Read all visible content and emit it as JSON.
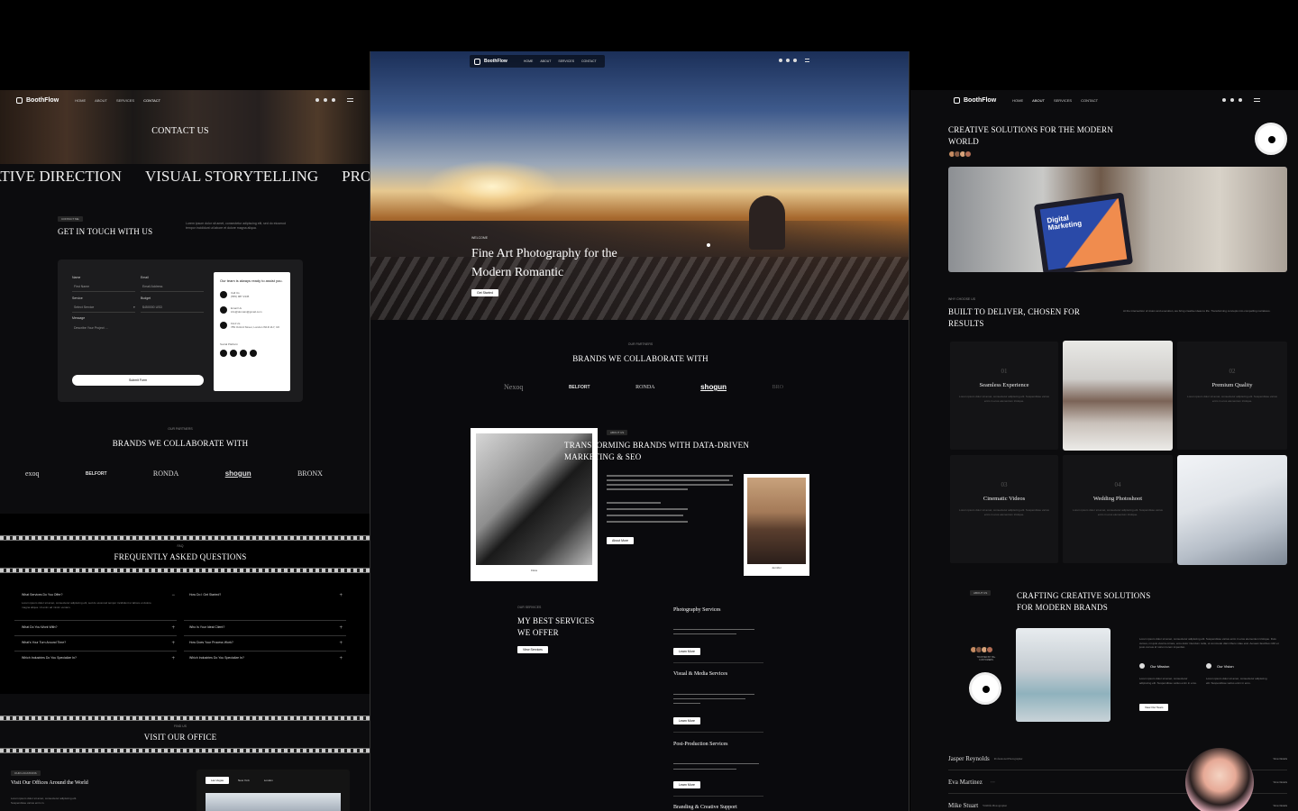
{
  "left": {
    "brand": "BoothFlow",
    "nav": [
      "HOME",
      "ABOUT",
      "SERVICES",
      "CONTACT"
    ],
    "hero_title": "CONTACT US",
    "marquee": [
      "ATIVE DIRECTION",
      "VISUAL STORYTELLING",
      "PROFESSIO"
    ],
    "get_in_touch": {
      "tag": "CONTACT ME",
      "title": "GET IN TOUCH WITH US",
      "desc": "Lorem ipsum dolor sit amet, consectetur adipiscing elit, sed do eiusmod tempor incididunt ut labore et dolore magna aliqua."
    },
    "form": {
      "name_label": "Name",
      "name_placeholder": "First Name",
      "email_label": "Email",
      "email_placeholder": "Email Address",
      "service_label": "Service",
      "service_value": "Select Service",
      "budget_label": "Budget",
      "budget_value": "$450000 USD",
      "message_label": "Message",
      "message_placeholder": "Describe Your Project ...",
      "submit": "Submit Form"
    },
    "contact_card": {
      "title": "Our team is always ready to assist you.",
      "call_label": "Call Us",
      "call_value": "(555) 987 2345",
      "email_label": "Email Us",
      "email_value": "info@domain@gmail.com",
      "find_label": "Find Us",
      "find_value": "789 Oxford Street, London W1D 2LY, UK",
      "social_label": "Social Platform"
    },
    "brands_tag": "OUR PARTNERS",
    "brands_title": "BRANDS WE COLLABORATE WITH",
    "brands": [
      "exoq",
      "BELFORT",
      "RONDA",
      "shogun",
      "BRONX"
    ],
    "faq_tag": "FAQ",
    "faq_title": "FREQUENTLY ASKED QUESTIONS",
    "faq_left": [
      {
        "q": "What Services Do You Offer?",
        "a": "Lorem ipsum dolor sit amet, consectetur adipiscing elit, sed do eiusmod tempor incididunt ut labore et dolore magna aliqua. Ut enim ad minim veniam.",
        "open": true
      },
      {
        "q": "What Do You Work With?",
        "open": false
      },
      {
        "q": "What's Your Turn Around Time?",
        "open": false
      },
      {
        "q": "Which Industries Do You Specialize In?",
        "open": false
      }
    ],
    "faq_right": [
      {
        "q": "How Do I Get Started?"
      },
      {
        "q": "Who Is Your Ideal Client?"
      },
      {
        "q": "How Does Your Process Work?"
      },
      {
        "q": "Which Industries Do You Specialize In?"
      }
    ],
    "office_tag": "FIND US",
    "office_title": "VISIT OUR OFFICE",
    "office_sub_tag": "OUR LOCATIONS",
    "office_heading": "Visit Our Offices Around the World",
    "office_desc": "Lorem ipsum dolor sit amet, consectetur adipiscing elit. Suspendisse varius enim in.",
    "office_tabs": [
      "Las Vegas",
      "New York",
      "London"
    ]
  },
  "center": {
    "brand": "BoothFlow",
    "nav": [
      "HOME",
      "ABOUT",
      "SERVICES",
      "CONTACT"
    ],
    "hero_tag": "WELCOME",
    "hero_title_1": "Fine Art Photography for the",
    "hero_title_2": "Modern Romantic",
    "hero_cta": "Get Started",
    "brands_tag": "OUR PARTNERS",
    "brands_title": "BRANDS WE COLLABORATE WITH",
    "brands": [
      "Nexoq",
      "BELFORT",
      "RONDA",
      "shogun",
      "BRO"
    ],
    "about_tag": "ABOUT US",
    "about_title_1": "TRANSFORMING BRANDS WITH DATA-DRIVEN",
    "about_title_2": "MARKETING & SEO",
    "about_cta": "About More",
    "photo_caption_1": "Flora",
    "photo_caption_2": "Jennifer",
    "services_tag": "OUR SERVICES",
    "services_title_1": "MY BEST SERVICES",
    "services_title_2": "WE OFFER",
    "services_cta": "View Services",
    "services": [
      {
        "title": "Photography Services",
        "cta": "Learn More"
      },
      {
        "title": "Visual & Media Services",
        "cta": "Learn More"
      },
      {
        "title": "Post-Production Services",
        "cta": "Learn More"
      },
      {
        "title": "Branding & Creative Support"
      }
    ]
  },
  "right": {
    "brand": "BoothFlow",
    "nav": [
      "HOME",
      "ABOUT",
      "SERVICES",
      "CONTACT"
    ],
    "hero_title_1": "CREATIVE SOLUTIONS FOR THE MODERN",
    "hero_title_2": "WORLD",
    "laptop_text_1": "Digital",
    "laptop_text_2": "Marketing",
    "why_tag": "WHY CHOOSE US",
    "why_title_1": "BUILT TO DELIVER, CHOSEN FOR",
    "why_title_2": "RESULTS",
    "why_desc": "At the intersection of vision and execution, we bring creative ideas to life. Transforming concepts into compelling narratives.",
    "tiles": [
      {
        "num": "01",
        "title": "Seamless Experience",
        "desc": "Lorem ipsum dolor sit amet, consectetur adipiscing elit. Suspendisse varius enim in eros elementum tristique."
      },
      {
        "num": "02",
        "title": "Premium Quality",
        "desc": "Lorem ipsum dolor sit amet, consectetur adipiscing elit. Suspendisse varius enim in eros elementum tristique."
      },
      {
        "num": "03",
        "title": "Cinematic Videos",
        "desc": "Lorem ipsum dolor sit amet, consectetur adipiscing elit. Suspendisse varius enim in eros elementum tristique."
      },
      {
        "num": "04",
        "title": "Wedding Photoshoot",
        "desc": "Lorem ipsum dolor sit amet, consectetur adipiscing elit. Suspendisse varius enim in eros elementum tristique."
      }
    ],
    "about_tag": "ABOUT US",
    "about_title_1": "CRAFTING CREATIVE SOLUTIONS",
    "about_title_2": "FOR MODERN BRANDS",
    "trusted": "TRUSTED BY 99+ CUSTOMERS",
    "about_desc": "Lorem ipsum dolor sit amet, consectetur adipiscing elit. Suspendisse varius enim in eros elementum tristique. Duis cursus, mi quis viverra ornare, eros dolor interdum nulla, ut commodo diam libero vitae erat. Aenean faucibus nibh et justo cursus id rutrum lorem imperdiet.",
    "mission": "Our Mission",
    "mission_desc": "Lorem ipsum dolor sit amet, consectetur adipiscing elit. Suspendisse varius enim in eros.",
    "vision": "Our Vision",
    "vision_desc": "Lorem ipsum dolor sit amet, consectetur adipiscing elit. Suspendisse varius enim in eros.",
    "about_cta": "View Our Team",
    "team": [
      {
        "name": "Jasper Reynolds",
        "role": "Professional Photographer",
        "view": "View Details"
      },
      {
        "name": "Eva Martinez",
        "role": "",
        "view": "View Details"
      },
      {
        "name": "Mike Stuart",
        "role": "Wildlife Photographer",
        "view": "View Details"
      }
    ]
  }
}
